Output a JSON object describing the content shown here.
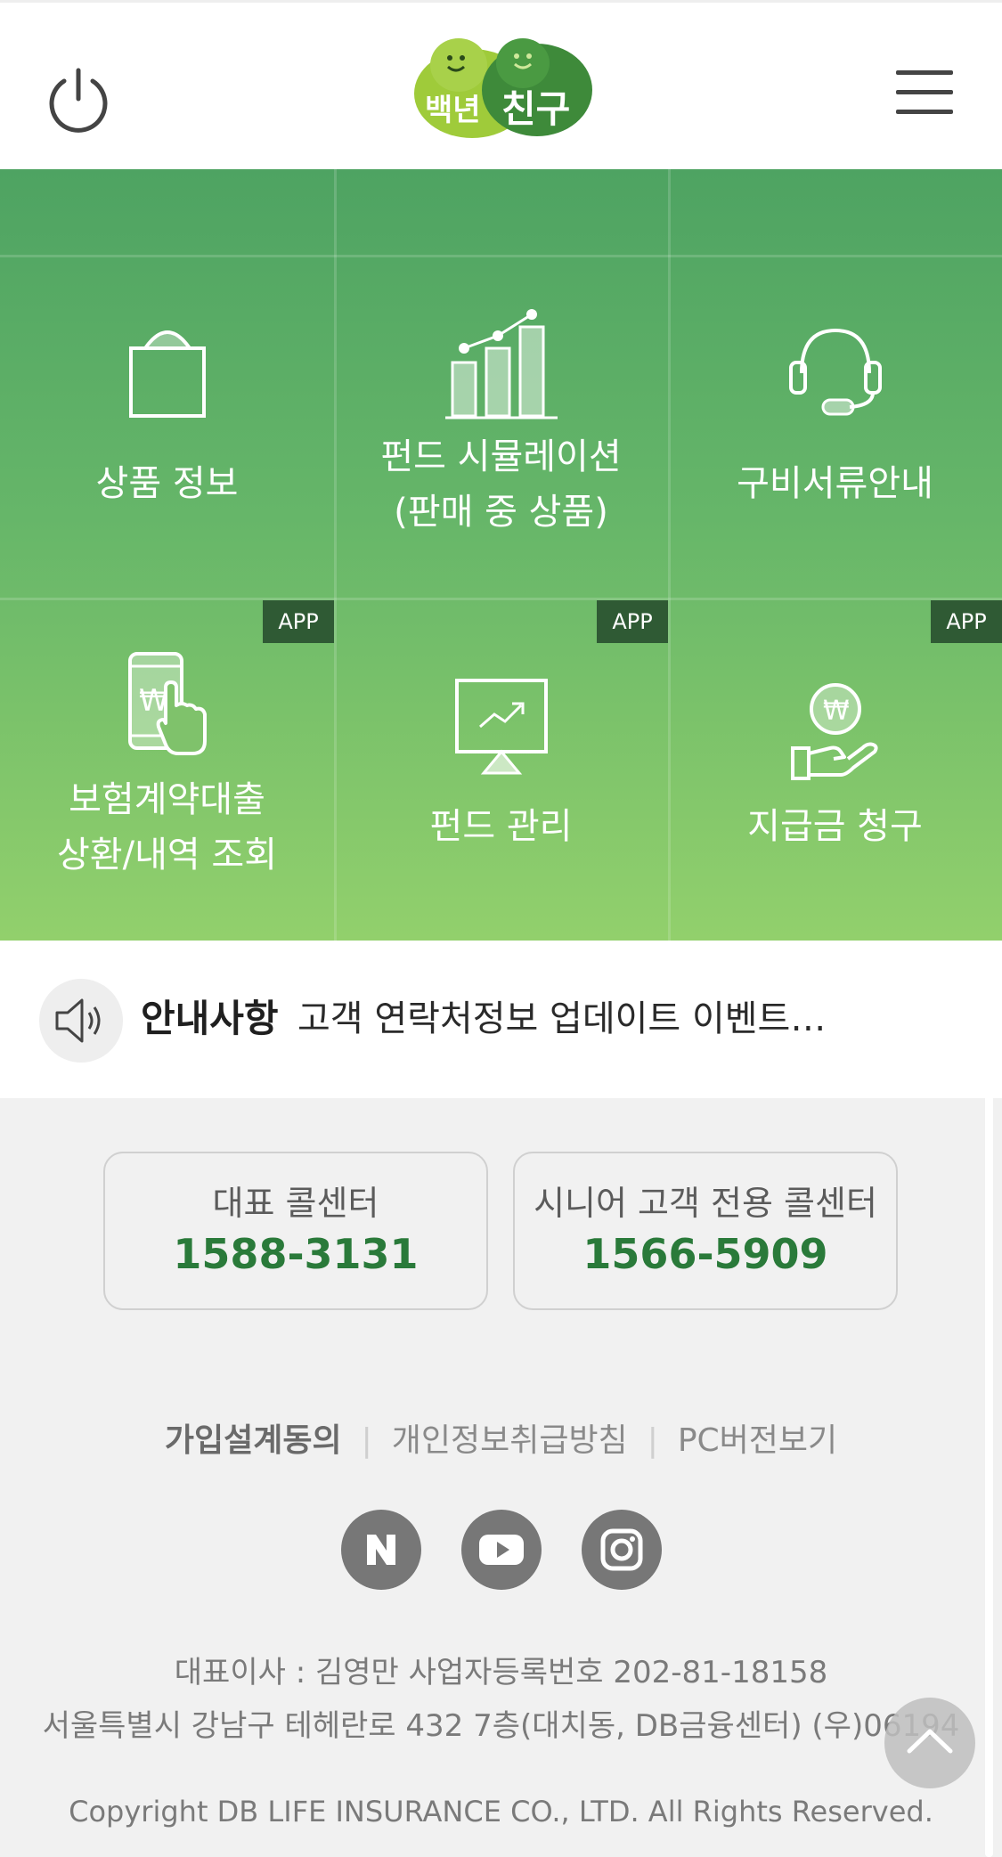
{
  "header": {
    "logo_text_left": "백년",
    "logo_text_right": "친구"
  },
  "grid": {
    "items": [
      {
        "label": "상품 정보",
        "icon": "shopping-bag-icon"
      },
      {
        "label": "펀드 시뮬레이션\n(판매 중 상품)",
        "icon": "bar-chart-icon"
      },
      {
        "label": "구비서류안내",
        "icon": "headset-icon"
      },
      {
        "label": "보험계약대출\n상환/내역 조회",
        "icon": "phone-won-icon",
        "badge": "APP"
      },
      {
        "label": "펀드 관리",
        "icon": "monitor-trend-icon",
        "badge": "APP"
      },
      {
        "label": "지급금 청구",
        "icon": "hand-coin-icon",
        "badge": "APP"
      }
    ],
    "won_symbol": "₩"
  },
  "notice": {
    "title": "안내사항",
    "text": "고객 연락처정보 업데이트 이벤트…"
  },
  "call_centers": [
    {
      "label": "대표 콜센터",
      "number": "1588-3131"
    },
    {
      "label": "시니어 고객 전용 콜센터",
      "number": "1566-5909"
    }
  ],
  "footer": {
    "links": [
      "가입설계동의",
      "개인정보취급방침",
      "PC버전보기"
    ],
    "biz_line1": "대표이사 : 김영만 사업자등록번호 202-81-18158",
    "biz_line2": "서울특별시 강남구 테헤란로 432 7층(대치동, DB금융센터) (우)06194",
    "copyright": "Copyright DB LIFE INSURANCE CO., LTD. All Rights Reserved."
  },
  "colors": {
    "green_top": "#4ea362",
    "green_bottom": "#92d06c",
    "badge_bg": "#2f5a34",
    "number_green": "#2a7a3a"
  }
}
